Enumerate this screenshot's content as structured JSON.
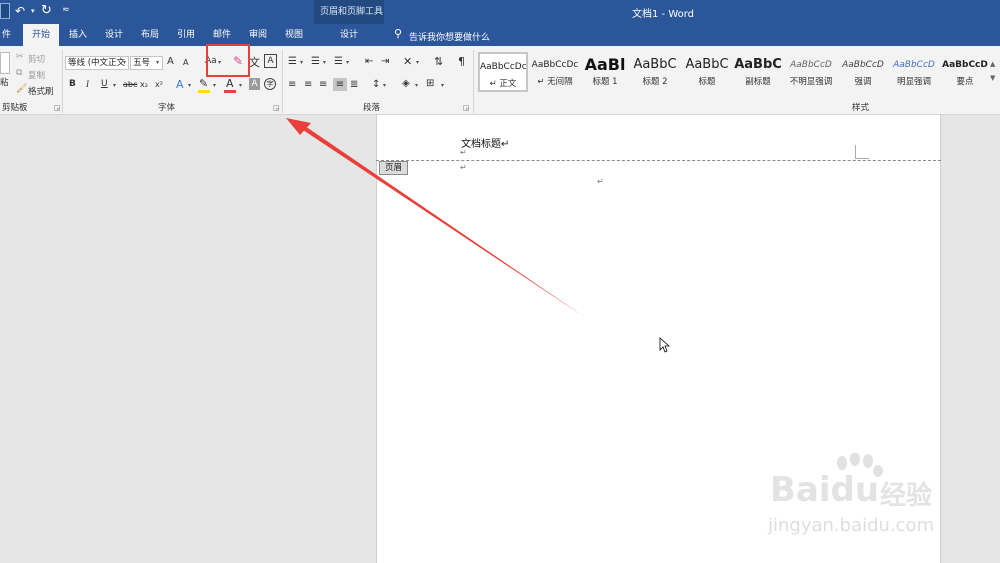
{
  "titlebar": {
    "doc_title": "文档1 - Word",
    "contextual_group": "页眉和页脚工具",
    "qat_customize": "≂"
  },
  "tabs": {
    "file": "件",
    "home": "开始",
    "insert": "插入",
    "design": "设计",
    "layout": "布局",
    "references": "引用",
    "mailings": "邮件",
    "review": "审阅",
    "view": "视图",
    "hf_design": "设计"
  },
  "tellme": "告诉我你想要做什么",
  "clipboard": {
    "paste": "粘",
    "cut": "剪切",
    "copy": "复制",
    "format_painter": "格式刷",
    "group_label": "剪贴板"
  },
  "font": {
    "font_name": "等线 (中文正文",
    "font_size": "五号",
    "grow": "A",
    "shrink": "A",
    "change_case": "Aa",
    "wen": "文",
    "box_a": "A",
    "bold": "B",
    "italic": "I",
    "underline": "U",
    "strike": "abc",
    "subscript": "x₂",
    "superscript": "x²",
    "effects": "A",
    "font_color": "A",
    "shading": "A",
    "enclose": "字",
    "group_label": "字体"
  },
  "paragraph": {
    "group_label": "段落"
  },
  "styles": {
    "group_label": "样式",
    "items": [
      {
        "sample": "AaBbCcDc",
        "name": "↵ 正文"
      },
      {
        "sample": "AaBbCcDc",
        "name": "↵ 无间隔"
      },
      {
        "sample": "AaBl",
        "name": "标题 1"
      },
      {
        "sample": "AaBbC",
        "name": "标题 2"
      },
      {
        "sample": "AaBbC",
        "name": "标题"
      },
      {
        "sample": "AaBbC",
        "name": "副标题"
      },
      {
        "sample": "AaBbCcD",
        "name": "不明显强调"
      },
      {
        "sample": "AaBbCcD",
        "name": "强调"
      },
      {
        "sample": "AaBbCcD",
        "name": "明显强调"
      },
      {
        "sample": "AaBbCcD",
        "name": "要点"
      }
    ]
  },
  "document": {
    "heading": "文档标题↵",
    "header_tag": "页眉",
    "pilcrow": "↵"
  },
  "watermark": {
    "brand": "Bai",
    "brand_du": "du",
    "cn": "经验",
    "url": "jingyan.baidu.com"
  },
  "colors": {
    "title_bar": "#2b579a",
    "ribbon": "#f3f3f3",
    "workspace": "#e6e6e6",
    "annotation": "#e8403a",
    "font_color_bar": "#e8403a",
    "highlight_bar": "#ffe000"
  }
}
